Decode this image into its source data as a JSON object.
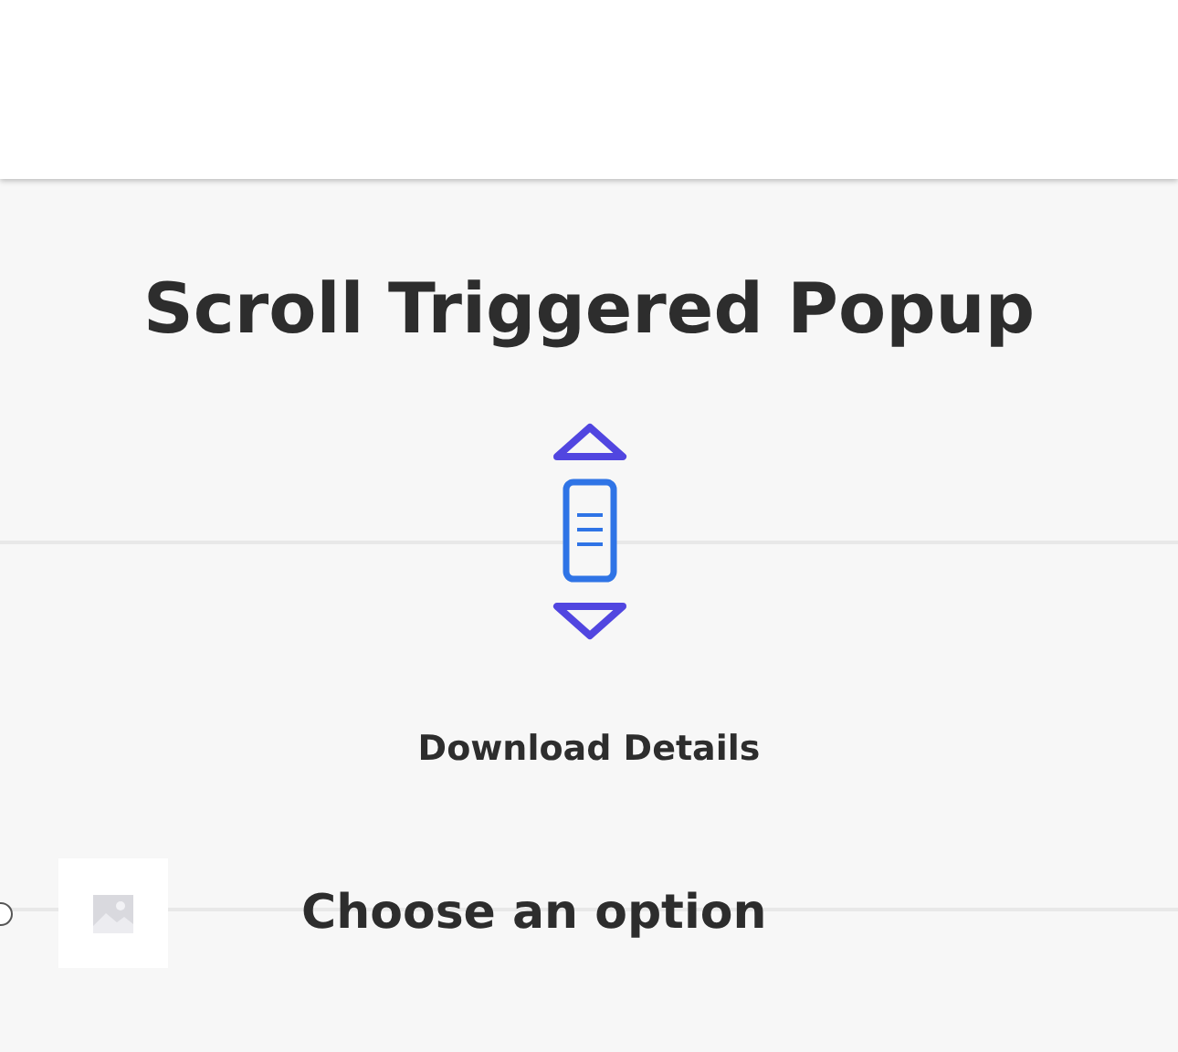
{
  "title": "Scroll Triggered Popup",
  "caption": "Download Details",
  "option": {
    "label": "Choose an option",
    "selected": false
  }
}
